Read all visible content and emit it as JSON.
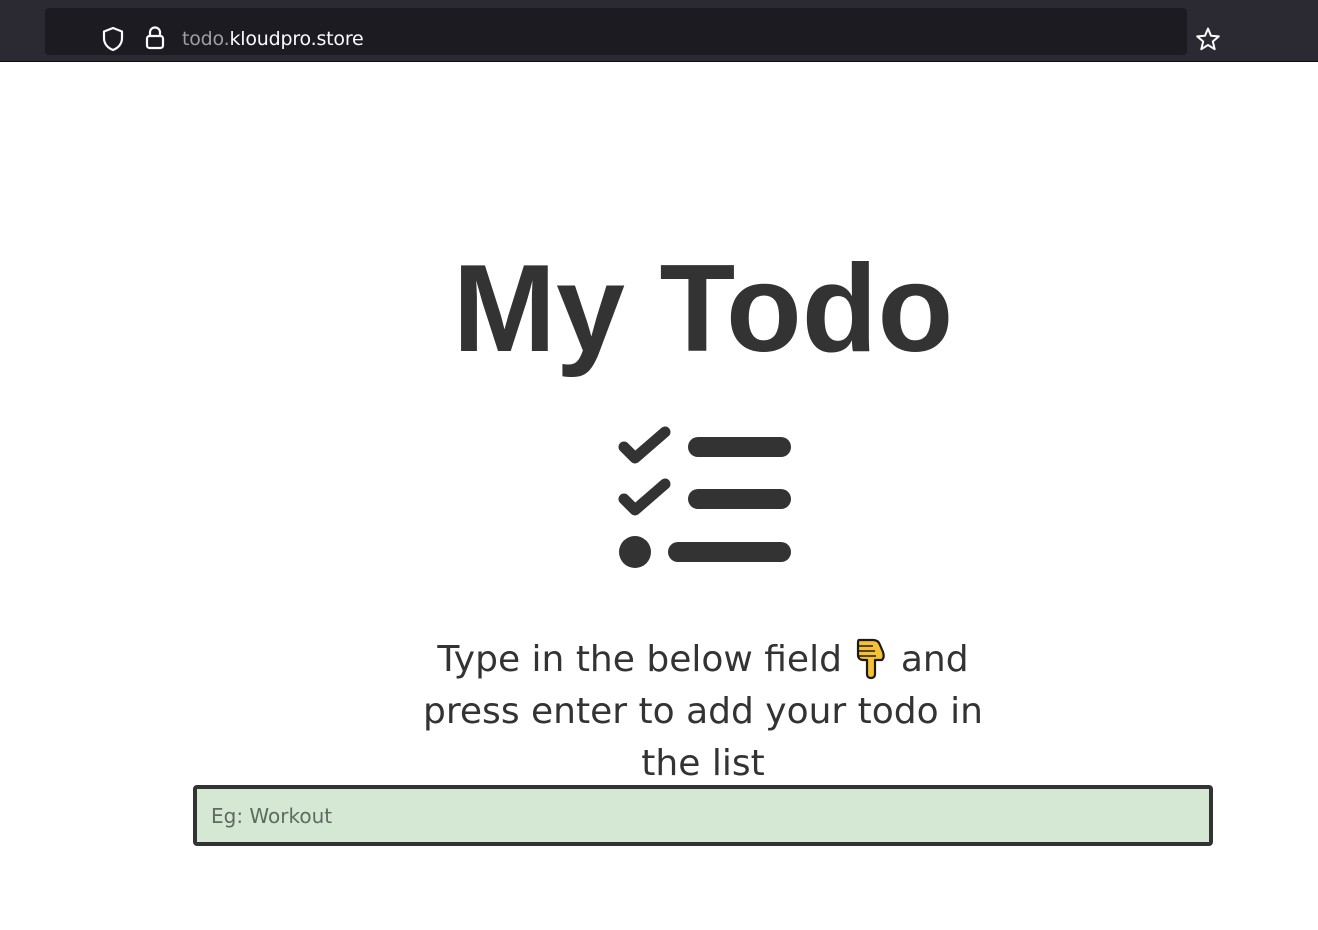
{
  "browser": {
    "url_subdomain": "todo.",
    "url_domain": "kloudpro.store",
    "icons": {
      "shield": "shield-icon",
      "lock": "lock-icon",
      "bookmark": "star-icon"
    }
  },
  "main": {
    "title": "My Todo",
    "instruction_part1": "Type in the below field",
    "instruction_part2": "and press enter to add your todo in the list",
    "input_value": "",
    "input_placeholder": "Eg: Workout",
    "icons": {
      "checklist": "checklist-icon",
      "pointing": "pointing-down-emoji"
    }
  },
  "colors": {
    "text": "#333333",
    "input_background": "#d4e8d4",
    "chrome_background": "#2b2a33"
  }
}
